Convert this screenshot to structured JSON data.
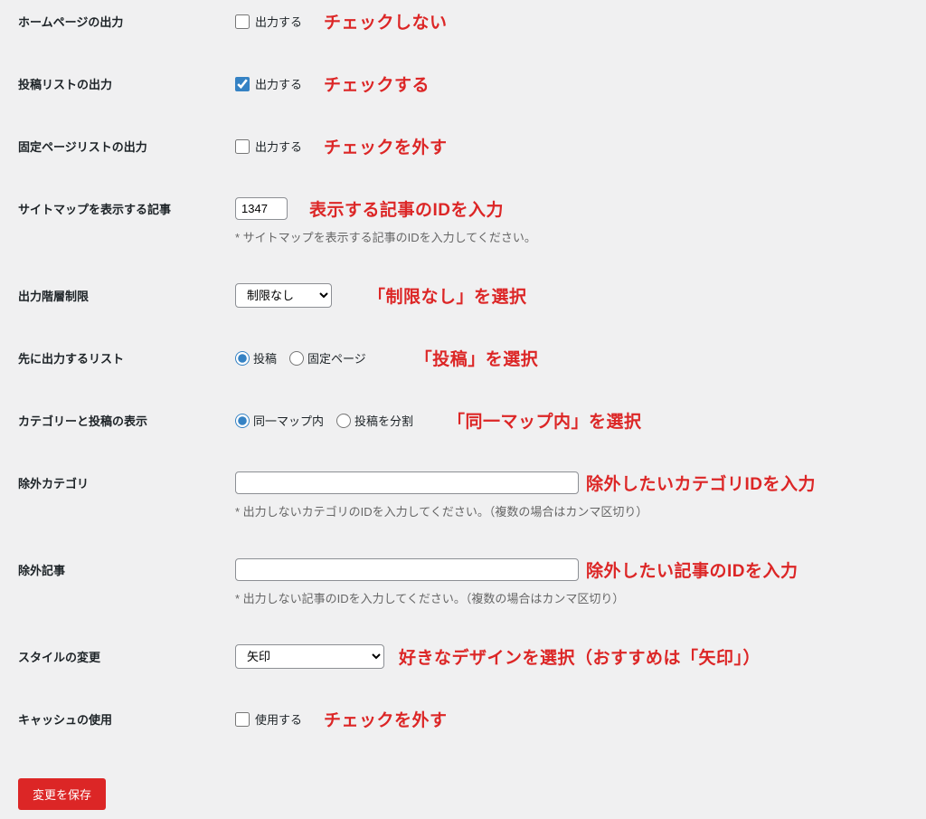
{
  "rows": {
    "homepage": {
      "label": "ホームページの出力",
      "checkbox_label": "出力する",
      "checked": false,
      "annotation": "チェックしない"
    },
    "post_list": {
      "label": "投稿リストの出力",
      "checkbox_label": "出力する",
      "checked": true,
      "annotation": "チェックする"
    },
    "page_list": {
      "label": "固定ページリストの出力",
      "checkbox_label": "出力する",
      "checked": false,
      "annotation": "チェックを外す"
    },
    "sitemap_post": {
      "label": "サイトマップを表示する記事",
      "value": "1347",
      "annotation": "表示する記事のIDを入力",
      "help": "* サイトマップを表示する記事のIDを入力してください。"
    },
    "depth_limit": {
      "label": "出力階層制限",
      "selected": "制限なし",
      "annotation": "「制限なし」を選択"
    },
    "first_list": {
      "label": "先に出力するリスト",
      "option1": "投稿",
      "option2": "固定ページ",
      "annotation": "「投稿」を選択"
    },
    "cat_post_display": {
      "label": "カテゴリーと投稿の表示",
      "option1": "同一マップ内",
      "option2": "投稿を分割",
      "annotation": "「同一マップ内」を選択"
    },
    "exclude_cat": {
      "label": "除外カテゴリ",
      "value": "",
      "annotation": "除外したいカテゴリIDを入力",
      "help": "* 出力しないカテゴリのIDを入力してください。（複数の場合はカンマ区切り）"
    },
    "exclude_post": {
      "label": "除外記事",
      "value": "",
      "annotation": "除外したい記事のIDを入力",
      "help": "* 出力しない記事のIDを入力してください。（複数の場合はカンマ区切り）"
    },
    "style": {
      "label": "スタイルの変更",
      "selected": "矢印",
      "annotation": "好きなデザインを選択（おすすめは「矢印」）"
    },
    "cache": {
      "label": "キャッシュの使用",
      "checkbox_label": "使用する",
      "checked": false,
      "annotation": "チェックを外す"
    }
  },
  "submit_label": "変更を保存"
}
